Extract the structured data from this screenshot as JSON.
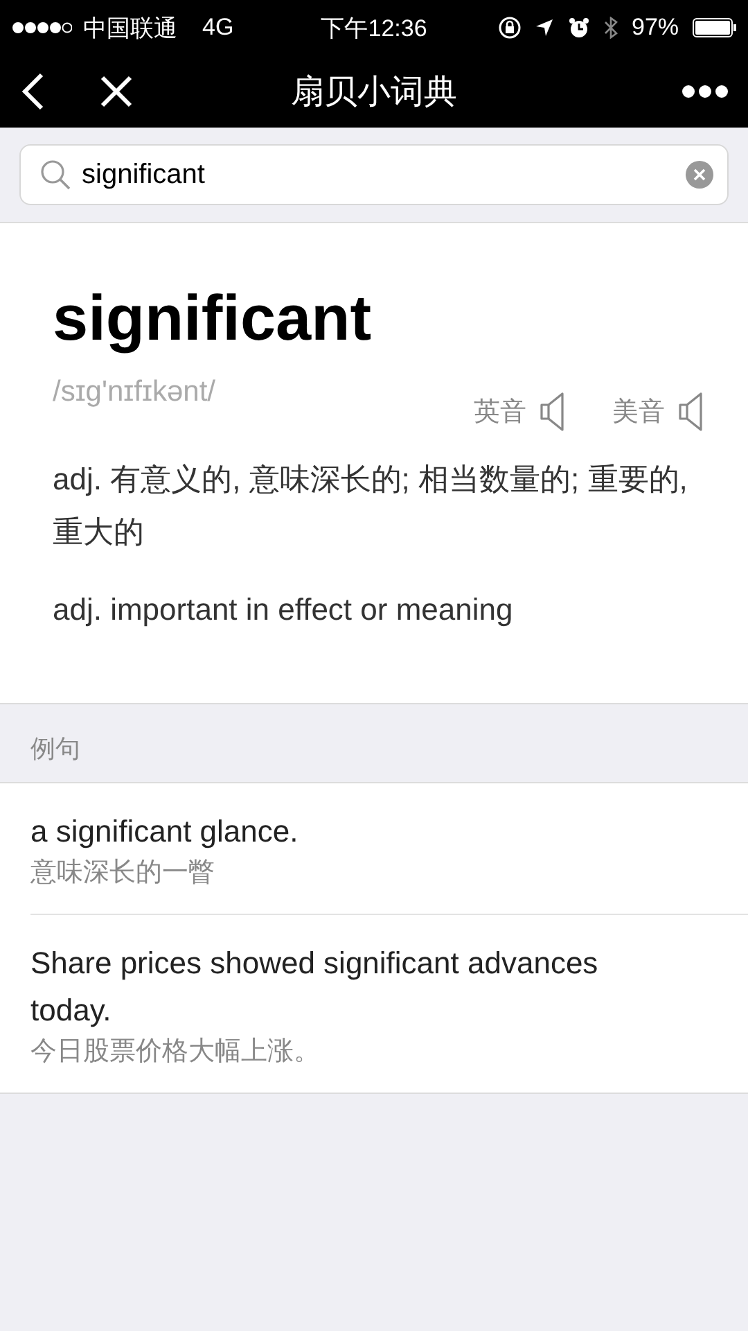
{
  "status_bar": {
    "carrier": "中国联通",
    "network": "4G",
    "time": "下午12:36",
    "battery": "97%"
  },
  "nav_bar": {
    "title": "扇贝小词典"
  },
  "search": {
    "value": "significant"
  },
  "entry": {
    "word": "significant",
    "phonetic": "/sɪg'nɪfɪkənt/",
    "pronunciations": [
      {
        "label": "英音"
      },
      {
        "label": "美音"
      }
    ],
    "definitions": [
      "adj. 有意义的, 意味深长的; 相当数量的; 重要的, 重大的",
      "adj. important in effect or meaning"
    ]
  },
  "examples": {
    "header": "例句",
    "items": [
      {
        "sentence": "a significant glance.",
        "translation": "意味深长的一瞥"
      },
      {
        "sentence": "Share prices showed significant advances today.",
        "translation": "今日股票价格大幅上涨。"
      }
    ]
  }
}
